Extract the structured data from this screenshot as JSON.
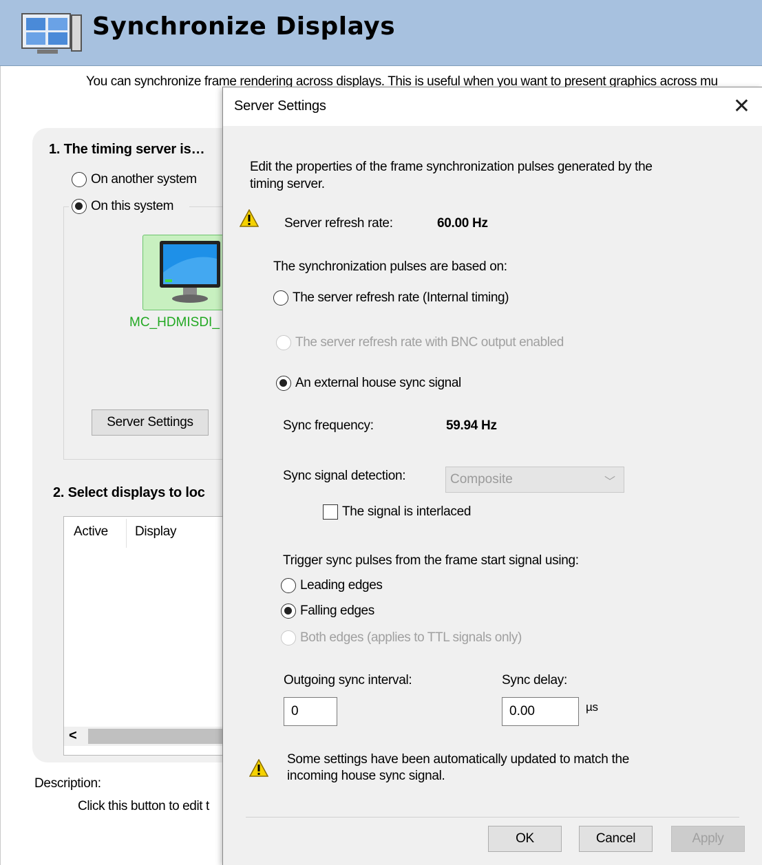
{
  "header": {
    "title": "Synchronize Displays"
  },
  "intro": "You can synchronize frame rendering across displays. This is useful when you want to present graphics across mu",
  "section1": {
    "title": "1. The timing server is…",
    "option_other": "On another system",
    "option_this": "On this system",
    "selected": "this",
    "display_name": "MC_HDMISDI_",
    "server_settings_button": "Server Settings"
  },
  "section2": {
    "title": "2. Select displays to loc",
    "columns": [
      "Active",
      "Display"
    ]
  },
  "description": {
    "label": "Description:",
    "text": "Click this button to edit t"
  },
  "dialog": {
    "title": "Server Settings",
    "intro_line1": "Edit the properties of the frame synchronization pulses generated by the",
    "intro_line2": "timing server.",
    "refresh_label": "Server refresh rate:",
    "refresh_value": "60.00 Hz",
    "pulses_label": "The synchronization pulses are based on:",
    "pulse_options": [
      {
        "label": "The server refresh rate (Internal timing)",
        "checked": false,
        "disabled": false
      },
      {
        "label": "The server refresh rate with BNC output enabled",
        "checked": false,
        "disabled": true
      },
      {
        "label": "An external house sync signal",
        "checked": true,
        "disabled": false
      }
    ],
    "sync_freq_label": "Sync frequency:",
    "sync_freq_value": "59.94 Hz",
    "detection_label": "Sync signal detection:",
    "detection_value": "Composite",
    "interlaced_label": "The signal is interlaced",
    "interlaced_checked": false,
    "trigger_label": "Trigger sync pulses from the frame start signal using:",
    "edge_options": [
      {
        "label": "Leading edges",
        "checked": false,
        "disabled": false
      },
      {
        "label": "Falling edges",
        "checked": true,
        "disabled": false
      },
      {
        "label": "Both edges (applies to TTL signals only)",
        "checked": false,
        "disabled": true
      }
    ],
    "interval_label": "Outgoing sync interval:",
    "interval_value": "0",
    "delay_label": "Sync delay:",
    "delay_value": "0.00",
    "delay_unit": "µs",
    "warning_line1": "Some settings have been automatically updated to match the",
    "warning_line2": "incoming house sync signal.",
    "ok_label": "OK",
    "cancel_label": "Cancel",
    "apply_label": "Apply"
  },
  "colors": {
    "header_bg": "#a7c1df",
    "panel_bg": "#f0f0f0",
    "display_label": "#22a822",
    "warning": "#f5d200"
  }
}
